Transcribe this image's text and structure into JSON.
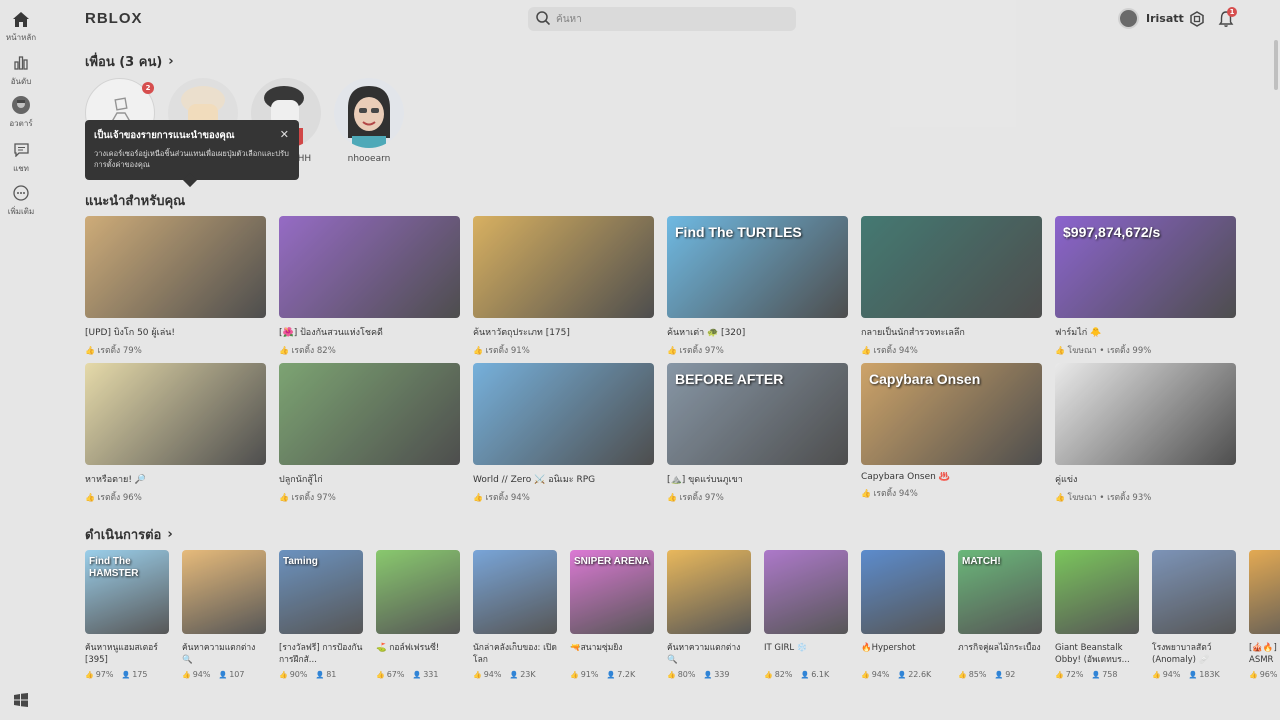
{
  "app": {
    "logo": "RBLOX"
  },
  "sidebar": {
    "items": [
      {
        "label": "หน้าหลัก",
        "icon": "home-icon"
      },
      {
        "label": "อันดับ",
        "icon": "chart-icon"
      },
      {
        "label": "อวตาร์",
        "icon": "avatar-icon"
      },
      {
        "label": "แชท",
        "icon": "chat-icon"
      },
      {
        "label": "เพิ่มเติม",
        "icon": "more-icon"
      }
    ]
  },
  "header": {
    "search_placeholder": "ค้นหา",
    "username": "Irisatt",
    "notification_count": "1"
  },
  "friends": {
    "title": "เพื่อน (3 คน)",
    "add_badge": "2",
    "items": [
      {
        "name": ""
      },
      {
        "name": "HHH"
      },
      {
        "name": "nhooearn"
      }
    ]
  },
  "tooltip": {
    "title": "เป็นเจ้าของรายการแนะนำของคุณ",
    "body": "วางเคอร์เซอร์อยู่เหนือชิ้นส่วนแทนเพื่อเผยปุ่มตัวเลือกและปรับการตั้งค่าของคุณ",
    "close": "✕"
  },
  "recommended": {
    "title": "แนะนำสำหรับคุณ",
    "items": [
      {
        "title": "[UPD] บิงโก 50 ผู้เล่น!",
        "meta": "เรตติ้ง 79%",
        "color": "#c9a36a"
      },
      {
        "title": "[🌺] ป้องกันสวนแห่งโชคดี",
        "meta": "เรตติ้ง 82%",
        "color": "#8a5bbf"
      },
      {
        "title": "ค้นหาวัตถุประเภท [175]",
        "meta": "เรตติ้ง 91%",
        "color": "#d4a84f"
      },
      {
        "title": "ค้นหาเต่า 🐢 [320]",
        "meta": "เรตติ้ง 97%",
        "color": "#5fb2e0"
      },
      {
        "title": "กลายเป็นนักสำรวจทะเลลึก",
        "meta": "เรตติ้ง 94%",
        "color": "#2f6b63"
      },
      {
        "title": "ฟาร์มไก่ 🐥",
        "meta": "โฆษณา • เรตติ้ง 99%",
        "color": "#7f53c9"
      },
      {
        "title": "หาหรือตาย! 🔎",
        "meta": "เรตติ้ง 96%",
        "color": "#e3d6a0"
      },
      {
        "title": "ปลูกนักสู้ไก่",
        "meta": "เรตติ้ง 97%",
        "color": "#6e9a63"
      },
      {
        "title": "World // Zero ⚔️ อนิเมะ RPG",
        "meta": "เรตติ้ง 94%",
        "color": "#67a8d8"
      },
      {
        "title": "[⛰️] ขุดแร่บนภูเขา",
        "meta": "เรตติ้ง 97%",
        "color": "#7a8b9c"
      },
      {
        "title": "Capybara Onsen ♨️",
        "meta": "เรตติ้ง 94%",
        "color": "#c99a58"
      },
      {
        "title": "คู่แข่ง",
        "meta": "โฆษณา • เรตติ้ง 93%",
        "color": "#e8e8e8"
      }
    ],
    "thumb_texts": [
      "",
      "",
      "",
      "Find The TURTLES",
      "",
      "$997,874,672/s",
      "",
      "",
      "",
      "BEFORE AFTER",
      "Capybara Onsen",
      ""
    ]
  },
  "continue": {
    "title": "ดำเนินการต่อ",
    "items": [
      {
        "title": "ค้นหาหนูแฮมสเตอร์ [395]",
        "rating": "97%",
        "players": "175",
        "color": "#8fc9e8",
        "tag": "Find The HAMSTER"
      },
      {
        "title": "ค้นหาความแตกต่าง 🔍",
        "rating": "94%",
        "players": "107",
        "color": "#e4b36c",
        "tag": ""
      },
      {
        "title": "[รางวัลฟรี] การป้องกันการฝึกสั...",
        "rating": "90%",
        "players": "81",
        "color": "#5b86b8",
        "tag": "Taming"
      },
      {
        "title": "⛳ กอล์ฟเฟรนซี่!",
        "rating": "67%",
        "players": "331",
        "color": "#7cc35e",
        "tag": ""
      },
      {
        "title": "นักล่าคลังเก็บของ: เปิดโลก",
        "rating": "94%",
        "players": "23K",
        "color": "#6a9bd4",
        "tag": ""
      },
      {
        "title": "🔫สนามซุ่มยิง",
        "rating": "91%",
        "players": "7.2K",
        "color": "#d86ad0",
        "tag": "SNIPER ARENA"
      },
      {
        "title": "ค้นหาความแตกต่าง 🔍",
        "rating": "80%",
        "players": "339",
        "color": "#e6b04a",
        "tag": ""
      },
      {
        "title": "IT GIRL ❄️",
        "rating": "82%",
        "players": "6.1K",
        "color": "#a46ac4",
        "tag": ""
      },
      {
        "title": "🔥Hypershot",
        "rating": "94%",
        "players": "22.6K",
        "color": "#4a7fc7",
        "tag": ""
      },
      {
        "title": "ภารกิจคู่ผลไม้กระเบื้อง",
        "rating": "85%",
        "players": "92",
        "color": "#5ab06b",
        "tag": "MATCH!"
      },
      {
        "title": "Giant Beanstalk Obby! (อัพเดทบร...",
        "rating": "72%",
        "players": "758",
        "color": "#6cbf4a",
        "tag": ""
      },
      {
        "title": "โรงพยาบาลสัตว์ (Anomaly) 🩹",
        "rating": "94%",
        "players": "183K",
        "color": "#6e88b0",
        "tag": ""
      },
      {
        "title": "[🎪🔥] ASMR",
        "rating": "96%",
        "players": "",
        "color": "#e0a040",
        "tag": ""
      }
    ]
  }
}
